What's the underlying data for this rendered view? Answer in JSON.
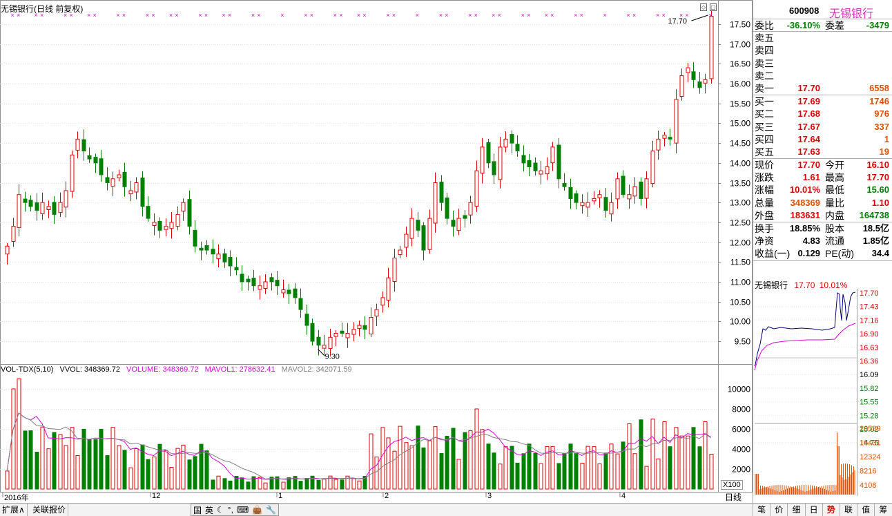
{
  "chart_title": "无锡银行(日线 前复权)",
  "price_axis": [
    "17.50",
    "17.00",
    "16.50",
    "16.00",
    "15.50",
    "15.00",
    "14.50",
    "14.00",
    "13.50",
    "13.00",
    "12.50",
    "12.00",
    "11.50",
    "11.00",
    "10.50",
    "10.00",
    "9.50"
  ],
  "vol_axis": [
    "10000",
    "8000",
    "6000",
    "4000",
    "2000"
  ],
  "vol_unit": "X100",
  "high_label": "17.70",
  "low_label": "9.30",
  "vol_legend": {
    "name": "VOL-TDX(5,10)",
    "vvol": "VVOL: 348369.72",
    "volume": "VOLUME: 348369.72",
    "mavol1": "MAVOL1: 278632.41",
    "mavol2": "MAVOL2: 342071.59"
  },
  "date_labels": [
    "2016年",
    "12",
    "1",
    "2",
    "3",
    "4"
  ],
  "period_label": "日线",
  "panel": {
    "code": "600908",
    "name": "无锡银行",
    "weibi_label": "委比",
    "weibi": "-36.10%",
    "weicha_label": "委差",
    "weicha": "-3479",
    "sell": [
      {
        "label": "卖五",
        "price": "",
        "vol": ""
      },
      {
        "label": "卖四",
        "price": "",
        "vol": ""
      },
      {
        "label": "卖三",
        "price": "",
        "vol": ""
      },
      {
        "label": "卖二",
        "price": "",
        "vol": ""
      },
      {
        "label": "卖一",
        "price": "17.70",
        "vol": "6558"
      }
    ],
    "buy": [
      {
        "label": "买一",
        "price": "17.69",
        "vol": "1746"
      },
      {
        "label": "买二",
        "price": "17.68",
        "vol": "976"
      },
      {
        "label": "买三",
        "price": "17.67",
        "vol": "337"
      },
      {
        "label": "买四",
        "price": "17.64",
        "vol": "1"
      },
      {
        "label": "买五",
        "price": "17.63",
        "vol": "19"
      }
    ],
    "quote": [
      {
        "l1": "现价",
        "v1": "17.70",
        "l2": "今开",
        "v2": "16.10",
        "c1": "red",
        "c2": "red"
      },
      {
        "l1": "涨跌",
        "v1": "1.61",
        "l2": "最高",
        "v2": "17.70",
        "c1": "red",
        "c2": "red"
      },
      {
        "l1": "涨幅",
        "v1": "10.01%",
        "l2": "最低",
        "v2": "15.60",
        "c1": "red",
        "c2": "green"
      },
      {
        "l1": "总量",
        "v1": "348369",
        "l2": "量比",
        "v2": "1.10",
        "c1": "org",
        "c2": "red"
      },
      {
        "l1": "外盘",
        "v1": "183631",
        "l2": "内盘",
        "v2": "164738",
        "c1": "red",
        "c2": "green"
      }
    ],
    "fund": [
      {
        "l1": "换手",
        "v1": "18.85%",
        "l2": "股本",
        "v2": "18.5亿"
      },
      {
        "l1": "净资",
        "v1": "4.83",
        "l2": "流通",
        "v2": "1.85亿"
      },
      {
        "l1": "收益(一)",
        "v1": "0.129",
        "l2": "PE(动)",
        "v2": "34.4"
      }
    ],
    "mini_name": "无锡银行",
    "mini_price": "17.70",
    "mini_pct": "10.01%",
    "mini_axis": [
      "17.70",
      "17.43",
      "17.16",
      "16.90",
      "16.63",
      "16.36",
      "16.09",
      "15.82",
      "15.55",
      "15.28",
      "15.02",
      "14.75"
    ],
    "mini_vol_axis": [
      "20539",
      "16431",
      "12324",
      "8216",
      "4108"
    ]
  },
  "bottom": {
    "tab1": "扩展∧",
    "tab2": "关联报价",
    "ime": [
      "国",
      "英",
      "☾",
      "°,",
      "⌨",
      "👜",
      "🔧"
    ],
    "right_tabs": [
      "笔",
      "价",
      "细",
      "日",
      "势",
      "联",
      "值",
      "筹"
    ],
    "active_tab": "势"
  },
  "colors": {
    "up": "#e00000",
    "down": "#008000",
    "ma1": "#e000e0",
    "ma2": "#808080",
    "grid": "#e0e0e0"
  }
}
